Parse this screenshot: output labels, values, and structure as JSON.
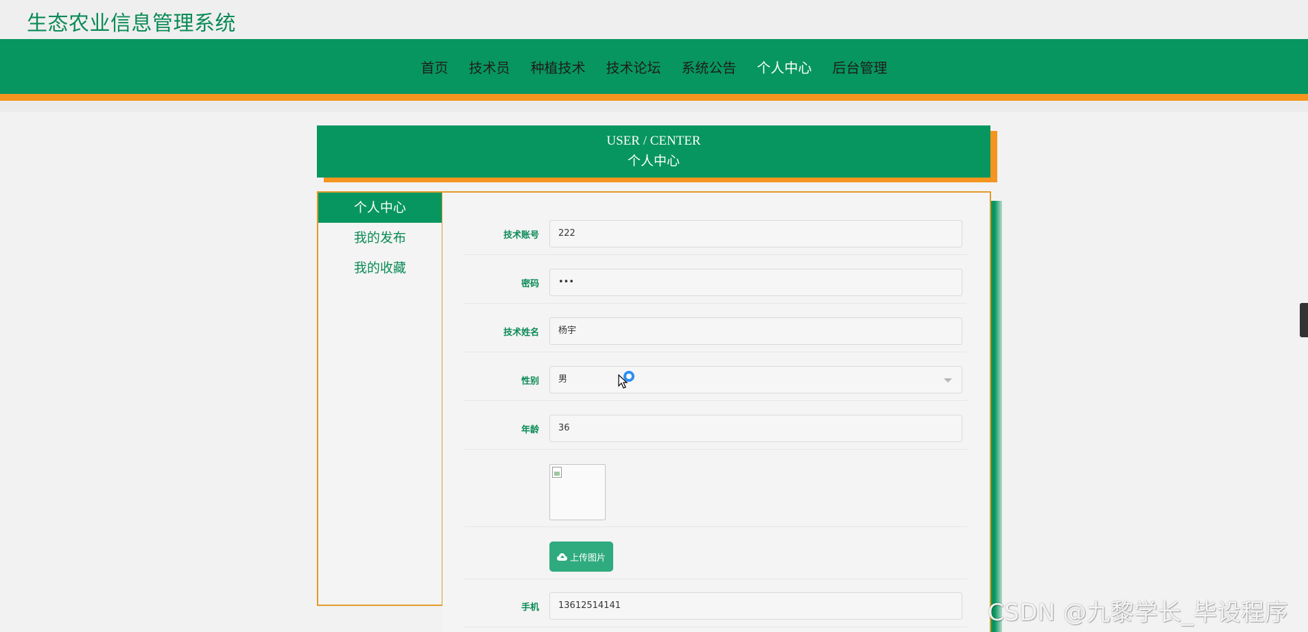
{
  "site": {
    "title": "生态农业信息管理系统"
  },
  "nav": {
    "items": [
      {
        "label": "首页"
      },
      {
        "label": "技术员"
      },
      {
        "label": "种植技术"
      },
      {
        "label": "技术论坛"
      },
      {
        "label": "系统公告"
      },
      {
        "label": "个人中心"
      },
      {
        "label": "后台管理"
      }
    ],
    "active": "个人中心"
  },
  "center": {
    "title_en": "USER / CENTER",
    "title_cn": "个人中心"
  },
  "sidebar": {
    "items": [
      {
        "label": "个人中心"
      },
      {
        "label": "我的发布"
      },
      {
        "label": "我的收藏"
      }
    ]
  },
  "form": {
    "account": {
      "label": "技术账号",
      "value": "222"
    },
    "password": {
      "label": "密码",
      "value": "•••"
    },
    "name": {
      "label": "技术姓名",
      "value": "杨宇"
    },
    "gender": {
      "label": "性别",
      "value": "男"
    },
    "age": {
      "label": "年龄",
      "value": "36"
    },
    "upload_label": "上传图片",
    "phone": {
      "label": "手机",
      "value": "13612514141"
    }
  },
  "watermark": "CSDN @九黎学长_毕设程序",
  "colors": {
    "primary": "#07965f",
    "accent": "#f4951f",
    "button": "#2fab7f"
  }
}
